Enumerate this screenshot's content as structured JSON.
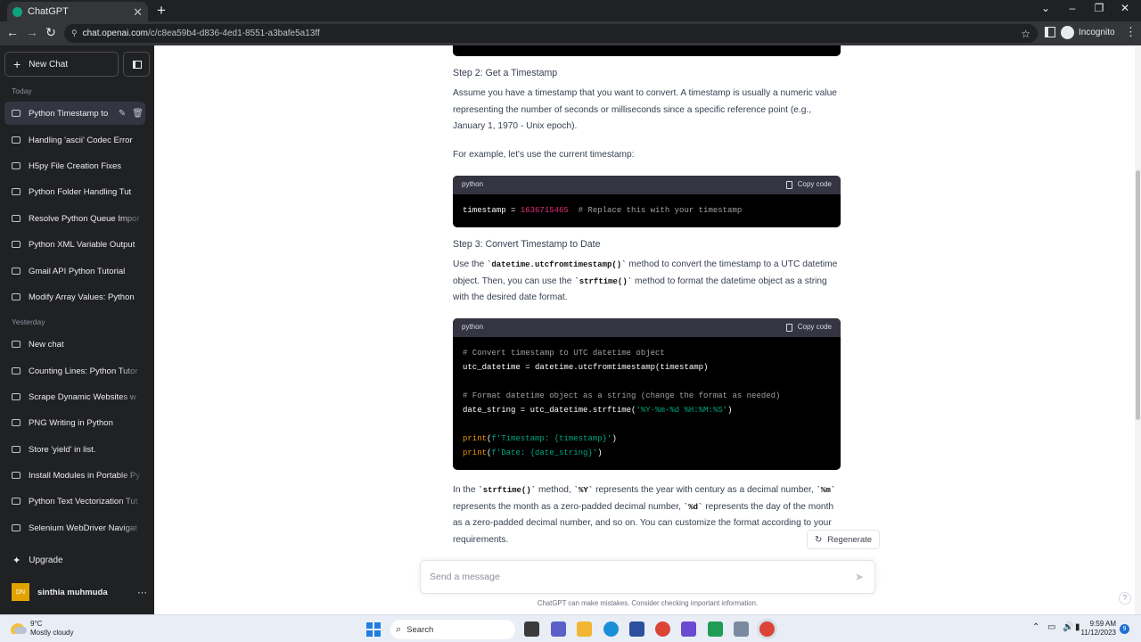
{
  "browser": {
    "tab_title": "ChatGPT",
    "url_host": "chat.openai.com",
    "url_path": "/c/c8ea59b4-d836-4ed1-8551-a3bafe5a13ff",
    "profile_label": "Incognito"
  },
  "sidebar": {
    "new_chat_label": "New Chat",
    "section_today": "Today",
    "section_yesterday": "Yesterday",
    "today": [
      "Python Timestamp to",
      "Handling 'ascii' Codec Error",
      "H5py File Creation Fixes",
      "Python Folder Handling Tut",
      "Resolve Python Queue Impor",
      "Python XML Variable Output",
      "Gmail API Python Tutorial",
      "Modify Array Values: Python"
    ],
    "yesterday": [
      "New chat",
      "Counting Lines: Python Tutor",
      "Scrape Dynamic Websites w",
      "PNG Writing in Python",
      "Store 'yield' in list.",
      "Install Modules in Portable Py",
      "Python Text Vectorization Tut",
      "Selenium WebDriver Navigat"
    ],
    "upgrade_label": "Upgrade",
    "user_initials": "DN",
    "user_name": "sinthia muhmuda"
  },
  "chat": {
    "step2_heading": "Step 2: Get a Timestamp",
    "step2_p1": "Assume you have a timestamp that you want to convert. A timestamp is usually a numeric value representing the number of seconds or milliseconds since a specific reference point (e.g., January 1, 1970 - Unix epoch).",
    "step2_p2": "For example, let's use the current timestamp:",
    "code1": {
      "lang": "python",
      "copy_label": "Copy code",
      "var": "timestamp = ",
      "num": "1636715465",
      "comment": "  # Replace this with your timestamp"
    },
    "step3_heading": "Step 3: Convert Timestamp to Date",
    "step3_p": {
      "a": "Use the ",
      "code_a": "`datetime.utcfromtimestamp()`",
      "b": " method to convert the timestamp to a UTC datetime object. Then, you can use the ",
      "code_b": "`strftime()`",
      "c": " method to format the datetime object as a string with the desired date format."
    },
    "code2": {
      "lang": "python",
      "copy_label": "Copy code",
      "l1": "# Convert timestamp to UTC datetime object",
      "l2": "utc_datetime = datetime.utcfromtimestamp(timestamp)",
      "l4": "# Format datetime object as a string (change the format as needed)",
      "l5a": "date_string = utc_datetime.strftime(",
      "l5s": "'%Y-%m-%d %H:%M:%S'",
      "l5b": ")",
      "l7a": "print",
      "l7b": "(",
      "l7s": "f'Timestamp: {timestamp}'",
      "l7c": ")",
      "l8a": "print",
      "l8b": "(",
      "l8s": "f'Date: {date_string}'",
      "l8c": ")"
    },
    "final_p": {
      "a": "In the ",
      "c1": "`strftime()`",
      "b": " method, ",
      "c2": "`%Y`",
      "c": " represents the year with century as a decimal number, ",
      "c3": "`%m`",
      "d": " represents the month as a zero-padded decimal number, ",
      "c4": "`%d`",
      "e": " represents the day of the month as a zero-padded decimal number, and so on. You can customize the format according to your requirements."
    },
    "regenerate_label": "Regenerate",
    "input_placeholder": "Send a message",
    "disclaimer": "ChatGPT can make mistakes. Consider checking important information.",
    "help_label": "?"
  },
  "taskbar": {
    "temp": "9°C",
    "weather": "Mostly cloudy",
    "search_label": "Search",
    "time": "9:59 AM",
    "date": "11/12/2023",
    "notif_count": "9"
  }
}
